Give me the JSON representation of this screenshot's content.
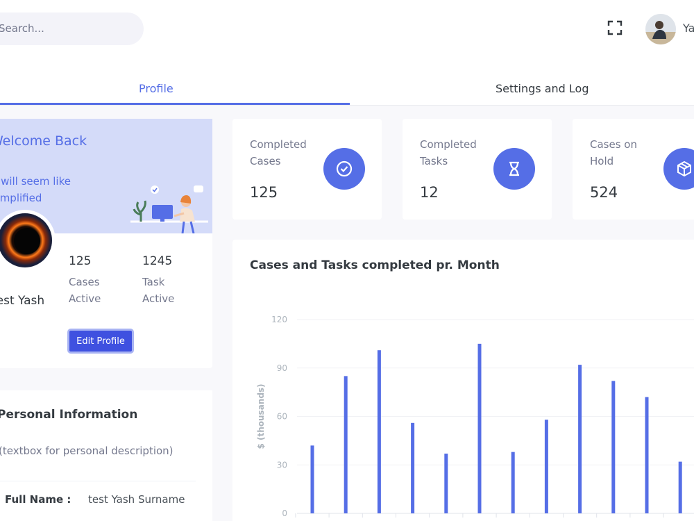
{
  "header": {
    "search_placeholder": "Search...",
    "username": "Yash"
  },
  "tabs": [
    {
      "label": "Profile",
      "active": true
    },
    {
      "label": "Settings and Log",
      "active": false
    }
  ],
  "welcome": {
    "title": "Welcome Back !",
    "subtitle": "It will seem like Simplified",
    "name": "test Yash",
    "stats": [
      {
        "value": "125",
        "label": "Cases Active"
      },
      {
        "value": "1245",
        "label": "Task Active"
      }
    ],
    "edit_button": "Edit Profile"
  },
  "personal_info": {
    "title": "Personal Information",
    "description": "(textbox for personal description)",
    "rows": [
      {
        "key": "Full Name :",
        "value": "test Yash Surname"
      }
    ]
  },
  "stat_cards": [
    {
      "label": "Completed Cases",
      "value": "125",
      "icon": "check-circle-icon"
    },
    {
      "label": "Completed Tasks",
      "value": "12",
      "icon": "hourglass-icon"
    },
    {
      "label": "Cases on Hold",
      "value": "524",
      "icon": "package-icon"
    }
  ],
  "colors": {
    "accent": "#556ee6",
    "banner": "#d4dbf9",
    "button": "#3f51e0"
  },
  "chart_data": {
    "type": "bar",
    "title": "Cases and Tasks completed pr. Month",
    "ylabel": "$ (thousands)",
    "ylim": [
      0,
      120
    ],
    "yticks": [
      0,
      30,
      60,
      90,
      120
    ],
    "series": [
      {
        "values": [
          42,
          85,
          101,
          56,
          37,
          105,
          38,
          58,
          92,
          82,
          72,
          32
        ]
      }
    ],
    "grid": true
  }
}
